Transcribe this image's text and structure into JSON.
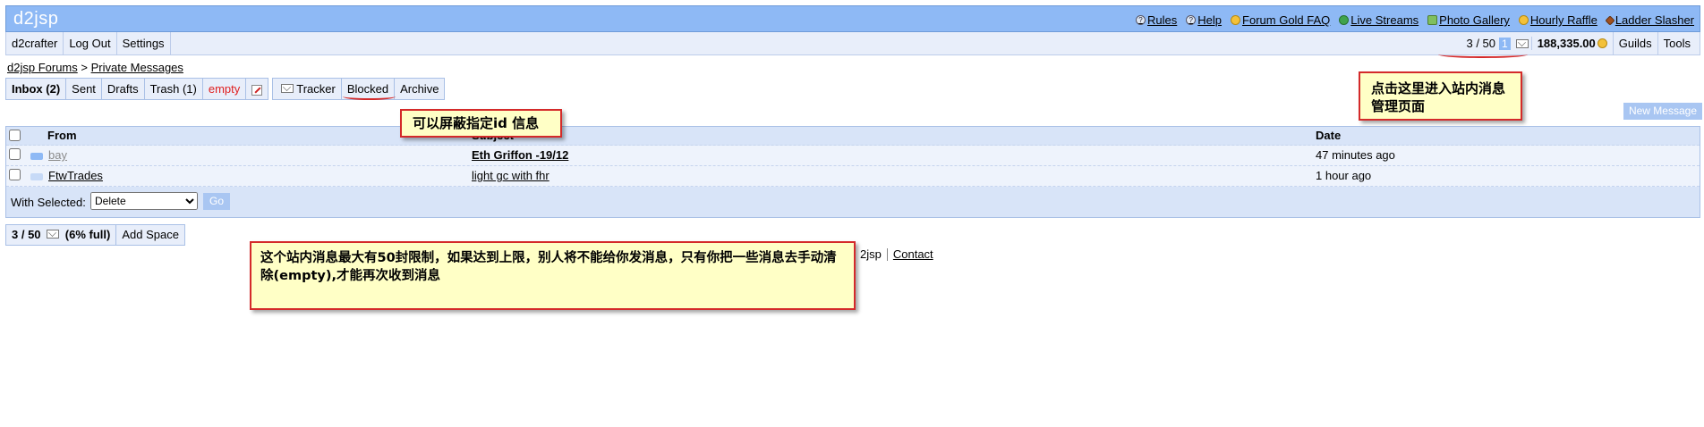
{
  "header": {
    "logo": "d2jsp",
    "links": [
      {
        "label": "Rules",
        "icon": "help-circle-icon"
      },
      {
        "label": "Help",
        "icon": "help-circle-icon"
      },
      {
        "label": "Forum Gold FAQ",
        "icon": "gold-coin-icon"
      },
      {
        "label": "Live Streams",
        "icon": "stream-icon"
      },
      {
        "label": "Photo Gallery",
        "icon": "gallery-icon"
      },
      {
        "label": "Hourly Raffle",
        "icon": "raffle-icon"
      },
      {
        "label": "Ladder Slasher",
        "icon": "hammer-icon"
      }
    ]
  },
  "userbar": {
    "username": "d2crafter",
    "logout": "Log Out",
    "settings": "Settings",
    "pm_count": "3 / 50",
    "pm_new": "1",
    "gold": "188,335.00",
    "guilds": "Guilds",
    "tools": "Tools"
  },
  "breadcrumb": {
    "root": "d2jsp Forums",
    "separator": ">",
    "current": "Private Messages"
  },
  "tabs": {
    "inbox": "Inbox (2)",
    "sent": "Sent",
    "drafts": "Drafts",
    "trash": "Trash (1)",
    "empty": "empty",
    "tracker": "Tracker",
    "blocked": "Blocked",
    "archive": "Archive"
  },
  "new_message": "New Message",
  "table": {
    "columns": {
      "from": "From",
      "subject": "Subject",
      "date": "Date"
    },
    "rows": [
      {
        "from": "bay",
        "subject": "Eth Griffon -19/12",
        "date": "47 minutes ago",
        "unread": true
      },
      {
        "from": "FtwTrades",
        "subject": "light gc with fhr",
        "date": "1 hour ago",
        "unread": false
      }
    ],
    "with_selected_label": "With Selected:",
    "action_options": [
      "Delete"
    ],
    "action_selected": "Delete",
    "go": "Go"
  },
  "quota": {
    "text": "3 / 50",
    "percent_text": "(6% full)",
    "add_space": "Add Space"
  },
  "footer": {
    "partial": "2jsp",
    "contact": "Contact"
  },
  "annotations": {
    "pm_page": "点击这里进入站内消息管理页面",
    "blocked": "可以屏蔽指定id 信息",
    "limit": "这个站内消息最大有50封限制，如果达到上限，别人将不能给你发消息，只有你把一些消息去手动清除(empty),才能再次收到消息"
  },
  "colors": {
    "header_bg": "#8eb9f5",
    "accent": "#a9c6f2",
    "callout_border": "#d42a2a",
    "callout_bg": "#ffffc6",
    "empty_link": "#e02020"
  }
}
